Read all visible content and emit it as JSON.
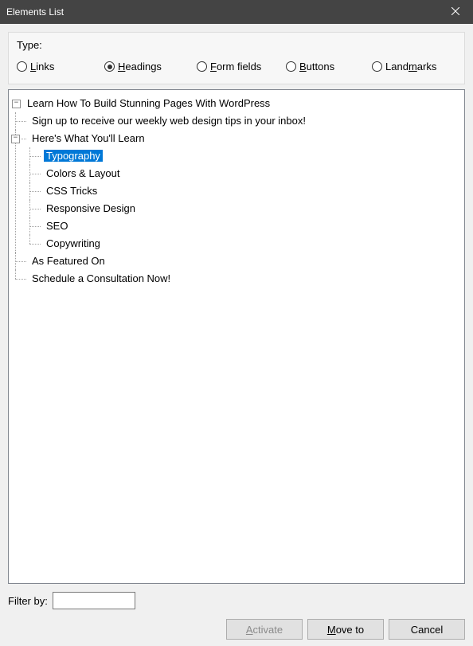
{
  "title": "Elements List",
  "type_label": "Type:",
  "radios": {
    "links": "inks",
    "headings": "eadings",
    "form": "orm fields",
    "buttons": "uttons",
    "landmarks": "and",
    "landmarks_suffix": "arks"
  },
  "tree": {
    "root": "Learn How To Build Stunning Pages With WordPress",
    "c1": "Sign up to receive our weekly web design tips in your inbox!",
    "c2": "Here's What You'll Learn",
    "c2_children": {
      "typography": "Typography",
      "colors": "Colors & Layout",
      "css": "CSS Tricks",
      "responsive": "Responsive Design",
      "seo": "SEO",
      "copy": "Copywriting"
    },
    "c3": "As Featured On",
    "c4": "Schedule a Consultation Now!"
  },
  "filter_label": "Filter by:",
  "buttons_row": {
    "activate": "ctivate",
    "moveto": "ove to",
    "cancel": "Cancel"
  }
}
